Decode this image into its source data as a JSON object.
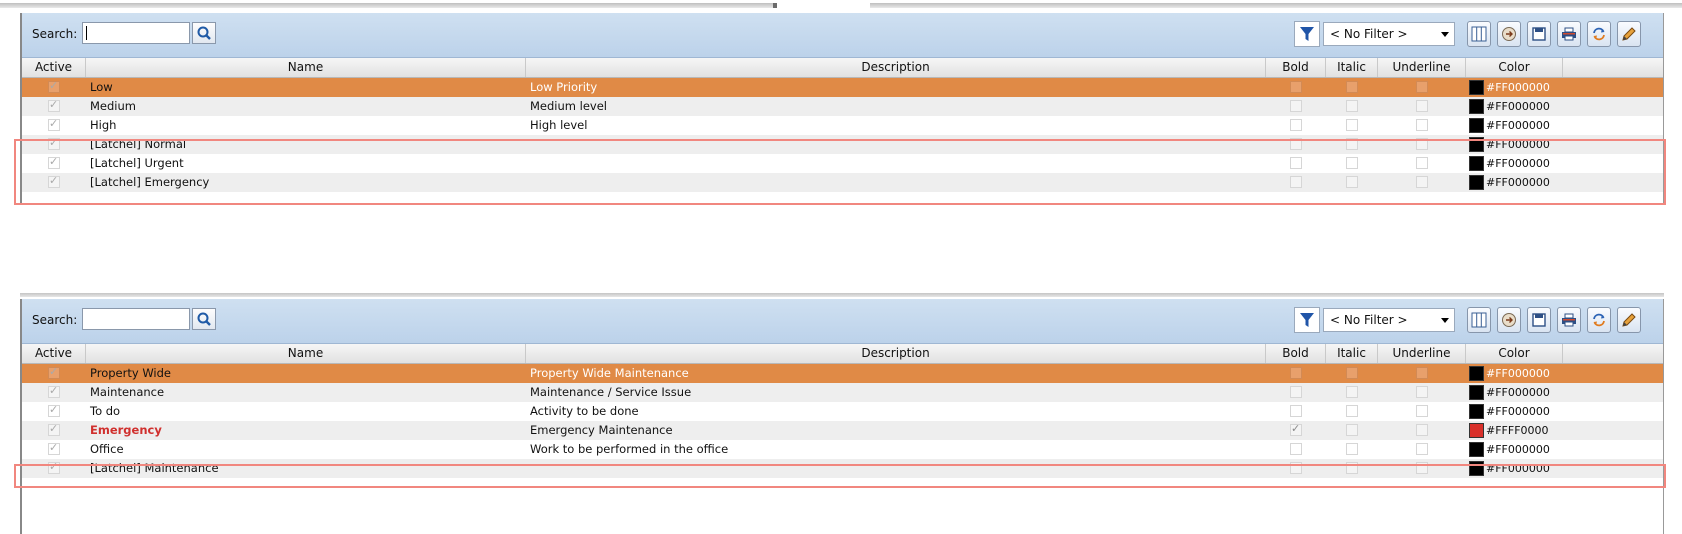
{
  "panels": [
    {
      "search": {
        "label": "Search:",
        "value": ""
      },
      "filter": {
        "selected": "< No Filter >"
      },
      "headers": {
        "active": "Active",
        "name": "Name",
        "description": "Description",
        "bold": "Bold",
        "italic": "Italic",
        "underline": "Underline",
        "color": "Color"
      },
      "rows": [
        {
          "name": "Low",
          "description": "Low Priority",
          "color_text": "#FF000000",
          "selected": true
        },
        {
          "name": "Medium",
          "description": "Medium level",
          "color_text": "#FF000000"
        },
        {
          "name": "High",
          "description": "High level",
          "color_text": "#FF000000"
        },
        {
          "name": "[Latchel] Normal",
          "description": "",
          "color_text": "#FF000000"
        },
        {
          "name": "[Latchel] Urgent",
          "description": "",
          "color_text": "#FF000000"
        },
        {
          "name": "[Latchel] Emergency",
          "description": "",
          "color_text": "#FF000000"
        }
      ]
    },
    {
      "search": {
        "label": "Search:",
        "value": ""
      },
      "filter": {
        "selected": "< No Filter >"
      },
      "headers": {
        "active": "Active",
        "name": "Name",
        "description": "Description",
        "bold": "Bold",
        "italic": "Italic",
        "underline": "Underline",
        "color": "Color"
      },
      "rows": [
        {
          "name": "Property Wide",
          "description": "Property Wide Maintenance",
          "color_text": "#FF000000",
          "selected": true
        },
        {
          "name": "Maintenance",
          "description": "Maintenance / Service Issue",
          "color_text": "#FF000000"
        },
        {
          "name": "To do",
          "description": "Activity to be done",
          "color_text": "#FF000000"
        },
        {
          "name": "Emergency",
          "description": "Emergency Maintenance",
          "color_text": "#FFFF0000",
          "bold": true
        },
        {
          "name": "Office",
          "description": "Work to be performed in the office",
          "color_text": "#FF000000"
        },
        {
          "name": "[Latchel] Maintenance",
          "description": "",
          "color_text": "#FF000000"
        }
      ]
    }
  ],
  "colors": {
    "selected_row": "#e08a46",
    "toolbar": "#c4d7ec",
    "highlight": "#f1877f",
    "swatch_black": "#000000",
    "swatch_red": "#d9302a"
  },
  "icons": [
    "search-icon",
    "filter-icon",
    "columns-icon",
    "export-icon",
    "save-icon",
    "print-icon",
    "refresh-icon",
    "edit-icon"
  ]
}
